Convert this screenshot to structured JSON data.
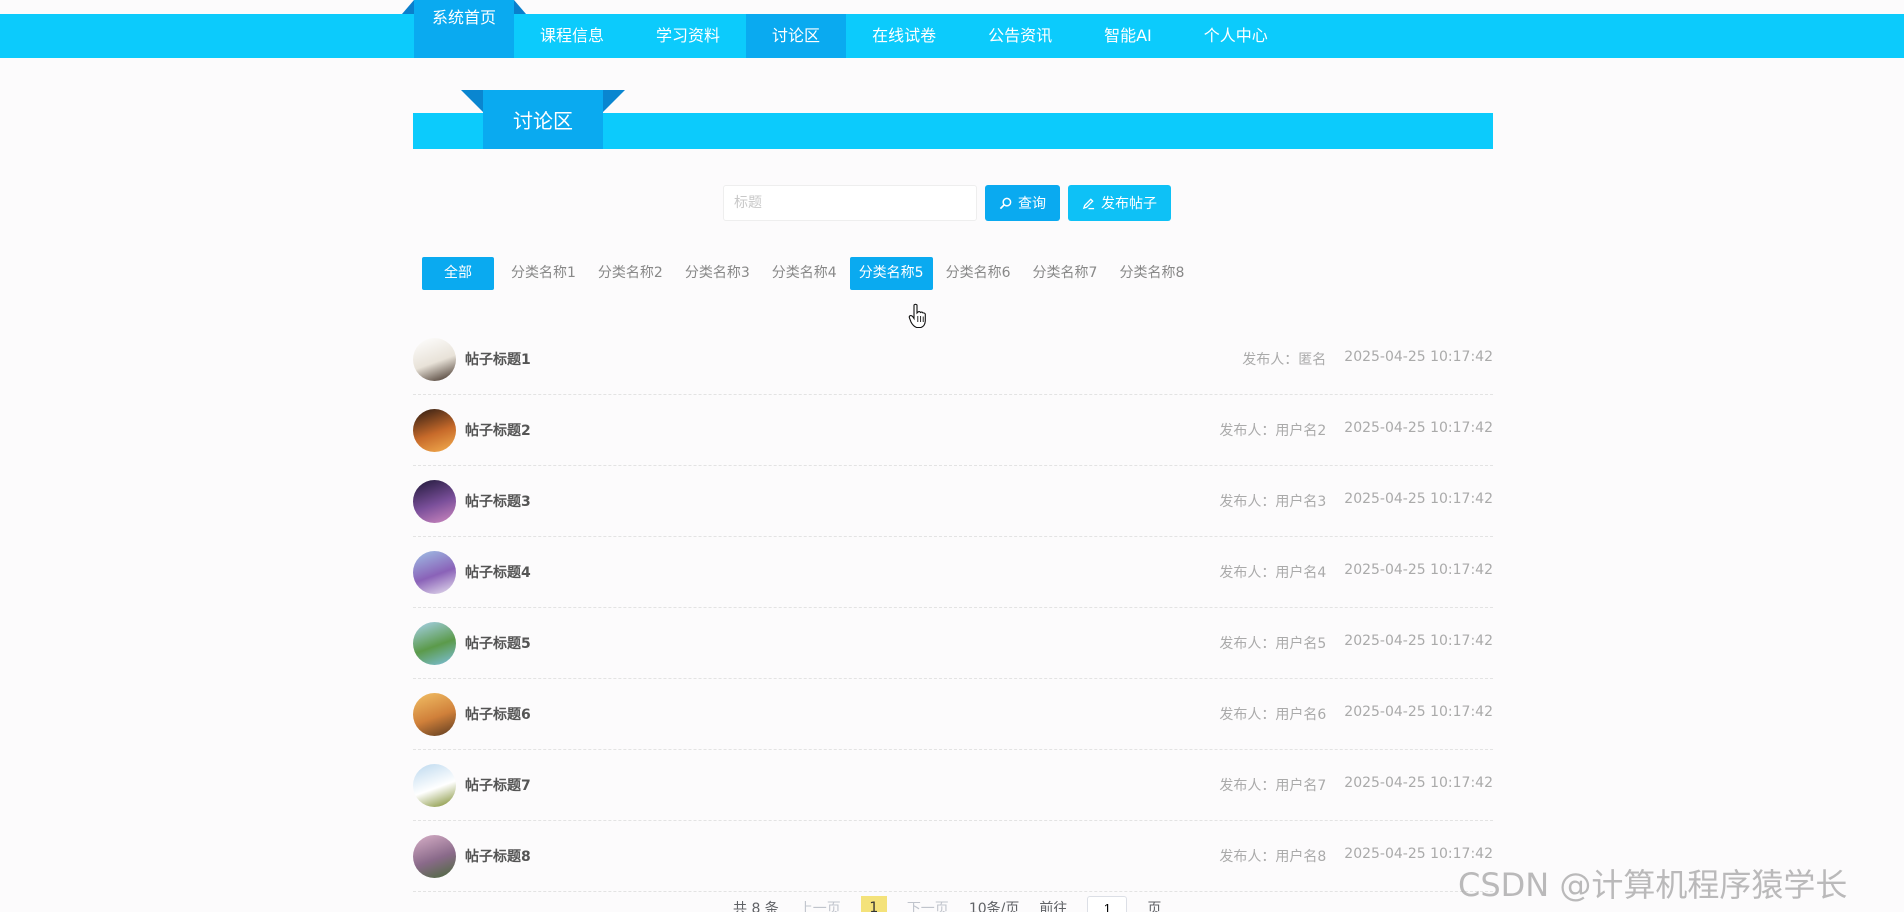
{
  "nav": {
    "items": [
      {
        "label": "系统首页"
      },
      {
        "label": "课程信息"
      },
      {
        "label": "学习资料"
      },
      {
        "label": "讨论区"
      },
      {
        "label": "在线试卷"
      },
      {
        "label": "公告资讯"
      },
      {
        "label": "智能AI"
      },
      {
        "label": "个人中心"
      }
    ],
    "active_index": 3
  },
  "section": {
    "title": "讨论区"
  },
  "search": {
    "placeholder": "标题",
    "value": "",
    "query_label": "查询",
    "publish_label": "发布帖子"
  },
  "categories": {
    "all_label": "全部",
    "items": [
      "分类名称1",
      "分类名称2",
      "分类名称3",
      "分类名称4",
      "分类名称5",
      "分类名称6",
      "分类名称7",
      "分类名称8"
    ],
    "active_index": 4
  },
  "posts": [
    {
      "title": "帖子标题1",
      "publisher": "发布人：匿名",
      "time": "2025-04-25 10:17:42",
      "avatar_colors": [
        "#ffffff",
        "#e8e2d8",
        "#3a2a20"
      ]
    },
    {
      "title": "帖子标题2",
      "publisher": "发布人：用户名2",
      "time": "2025-04-25 10:17:42",
      "avatar_colors": [
        "#2a1a12",
        "#c76a2a",
        "#f5b050"
      ]
    },
    {
      "title": "帖子标题3",
      "publisher": "发布人：用户名3",
      "time": "2025-04-25 10:17:42",
      "avatar_colors": [
        "#1f1838",
        "#7a4f9a",
        "#d08ac0"
      ]
    },
    {
      "title": "帖子标题4",
      "publisher": "发布人：用户名4",
      "time": "2025-04-25 10:17:42",
      "avatar_colors": [
        "#9fc1e6",
        "#8a62b8",
        "#e8e2f0"
      ]
    },
    {
      "title": "帖子标题5",
      "publisher": "发布人：用户名5",
      "time": "2025-04-25 10:17:42",
      "avatar_colors": [
        "#a8d2ec",
        "#5b9a4a",
        "#7ec0e0"
      ]
    },
    {
      "title": "帖子标题6",
      "publisher": "发布人：用户名6",
      "time": "2025-04-25 10:17:42",
      "avatar_colors": [
        "#f2c066",
        "#d0803a",
        "#5a3a20"
      ]
    },
    {
      "title": "帖子标题7",
      "publisher": "发布人：用户名7",
      "time": "2025-04-25 10:17:42",
      "avatar_colors": [
        "#bcd8ee",
        "#ffffff",
        "#7a8a2a"
      ]
    },
    {
      "title": "帖子标题8",
      "publisher": "发布人：用户名8",
      "time": "2025-04-25 10:17:42",
      "avatar_colors": [
        "#d8b0c8",
        "#8a6a8a",
        "#4a6a3a"
      ]
    }
  ],
  "pager": {
    "total": "共 8 条",
    "prev": "上一页",
    "page": "1",
    "next": "下一页",
    "size": "10条/页",
    "goto": "前往",
    "goto_value": "1",
    "page_unit": "页"
  },
  "watermark": "CSDN @计算机程序猿学长"
}
